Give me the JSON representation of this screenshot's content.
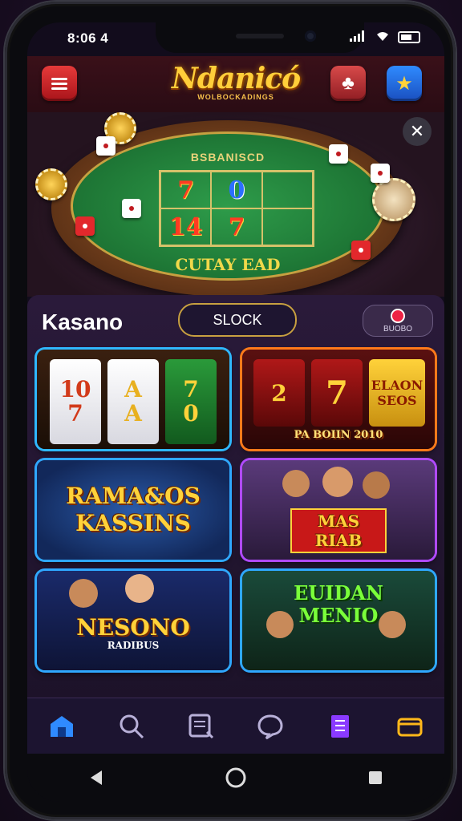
{
  "status_bar": {
    "time": "8:06 4"
  },
  "header": {
    "logo_title": "Ndanicó",
    "logo_subtitle": "WOLBOCKADINGS",
    "menu_icon": "hamburger-icon",
    "cards_icon": "cards-icon",
    "promo_icon": "star-icon"
  },
  "banner": {
    "felt_title": "BSBANISCD",
    "felt_bottom": "CUTAY EAD",
    "felt_cells": [
      "7",
      "0",
      "",
      "14",
      "7",
      ""
    ],
    "close_icon": "close-icon"
  },
  "section": {
    "title": "Kasano",
    "filter_label": "SLOCK",
    "sort_label": "BUOBO"
  },
  "games": [
    {
      "name": "",
      "reels": [
        "10\n7",
        "A\nA",
        "7\n0"
      ],
      "border": "#2fb8ff"
    },
    {
      "name": "PA BOIIN 2010",
      "reels": [
        "2\n",
        "7",
        "ELAON\nSEOS"
      ],
      "border": "#ff7a1a"
    },
    {
      "name": "RAMA&OS\nKASSINS",
      "border": "#2fa8ff"
    },
    {
      "name": "MAS RIAB",
      "border": "#b04aff"
    },
    {
      "name": "NESONO",
      "subtitle": "RADIBUS",
      "border": "#2fa8ff"
    },
    {
      "name": "EUIDAN\nMENIO",
      "border": "#2fa8ff"
    }
  ],
  "tabbar": {
    "tabs": [
      "home-icon",
      "search-icon",
      "news-icon",
      "chat-icon",
      "book-icon",
      "wallet-icon"
    ]
  },
  "system_nav": {
    "back": "back-icon",
    "home": "home-circle-icon",
    "recents": "recents-icon"
  }
}
